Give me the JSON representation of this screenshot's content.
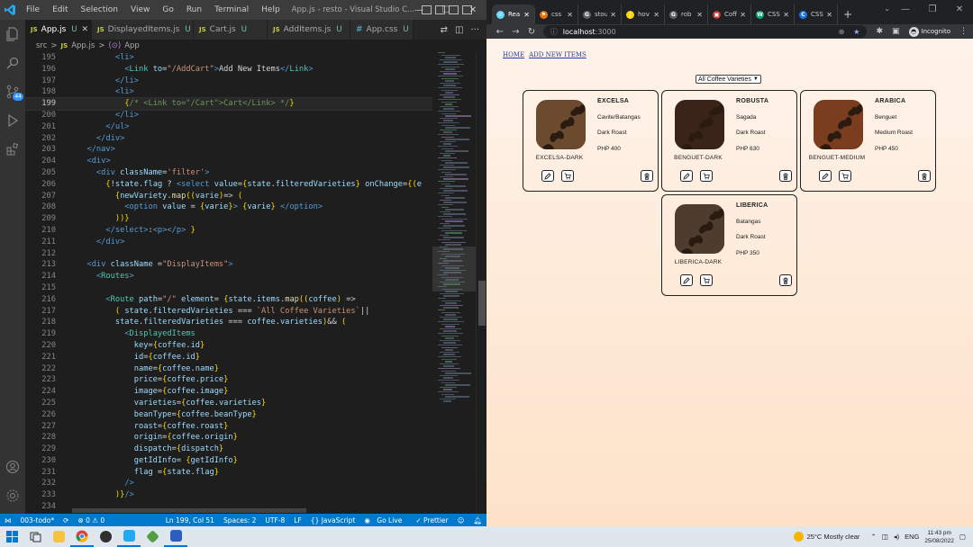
{
  "vscode": {
    "menu": [
      "File",
      "Edit",
      "Selection",
      "View",
      "Go",
      "Run",
      "Terminal",
      "Help"
    ],
    "window_title": "App.js - resto - Visual Studio C...",
    "tabs": [
      {
        "label": "App.js",
        "icon": "JS",
        "status": "U",
        "active": true
      },
      {
        "label": "DisplayedItems.js",
        "icon": "JS",
        "status": "U",
        "active": false
      },
      {
        "label": "Cart.js",
        "icon": "JS",
        "status": "U",
        "active": false
      },
      {
        "label": "AddItems.js",
        "icon": "JS",
        "status": "U",
        "active": false
      },
      {
        "label": "App.css",
        "icon": "#",
        "status": "U",
        "active": false
      }
    ],
    "breadcrumb": {
      "folder": "src",
      "file": "App.js",
      "symbol": "App"
    },
    "source_control_badge": "44",
    "current_line": 199,
    "status_bar": {
      "branch": "003-todo*",
      "sync": "⟳",
      "problems": "⊗ 0 ⚠ 0",
      "position": "Ln 199, Col 51",
      "spaces": "Spaces: 2",
      "encoding": "UTF-8",
      "eol": "LF",
      "language": "{} JavaScript",
      "golive": "Go Live",
      "prettier": "✓ Prettier"
    }
  },
  "code_lines": [
    {
      "n": 195,
      "t": [
        [
          "tx",
          "        "
        ],
        [
          "tg",
          "<li>"
        ]
      ]
    },
    {
      "n": 196,
      "t": [
        [
          "tx",
          "          "
        ],
        [
          "tg",
          "<"
        ],
        [
          "cp",
          "Link"
        ],
        [
          "tx",
          " "
        ],
        [
          "at",
          "to"
        ],
        [
          "tx",
          "="
        ],
        [
          "st",
          "\"/AddCart\""
        ],
        [
          "tg",
          ">"
        ],
        [
          "tx",
          "Add New Items"
        ],
        [
          "tg",
          "</"
        ],
        [
          "cp",
          "Link"
        ],
        [
          "tg",
          ">"
        ]
      ]
    },
    {
      "n": 197,
      "t": [
        [
          "tx",
          "        "
        ],
        [
          "tg",
          "</li>"
        ]
      ]
    },
    {
      "n": 198,
      "t": [
        [
          "tx",
          "        "
        ],
        [
          "tg",
          "<li>"
        ]
      ]
    },
    {
      "n": 199,
      "t": [
        [
          "tx",
          "          "
        ],
        [
          "br",
          "{"
        ],
        [
          "cm",
          "/* <Link to=\"/Cart\">Cart</Link> */"
        ],
        [
          "br",
          "}"
        ]
      ]
    },
    {
      "n": 200,
      "t": [
        [
          "tx",
          "        "
        ],
        [
          "tg",
          "</li>"
        ]
      ]
    },
    {
      "n": 201,
      "t": [
        [
          "tx",
          "      "
        ],
        [
          "tg",
          "</ul>"
        ]
      ]
    },
    {
      "n": 202,
      "t": [
        [
          "tx",
          "    "
        ],
        [
          "tg",
          "</div>"
        ]
      ]
    },
    {
      "n": 203,
      "t": [
        [
          "tx",
          "  "
        ],
        [
          "tg",
          "</nav>"
        ]
      ]
    },
    {
      "n": 204,
      "t": [
        [
          "tx",
          "  "
        ],
        [
          "tg",
          "<div>"
        ]
      ]
    },
    {
      "n": 205,
      "t": [
        [
          "tx",
          "    "
        ],
        [
          "tg",
          "<div"
        ],
        [
          "tx",
          " "
        ],
        [
          "at",
          "className"
        ],
        [
          "tx",
          "="
        ],
        [
          "st",
          "'filter'"
        ],
        [
          "tg",
          ">"
        ]
      ]
    },
    {
      "n": 206,
      "t": [
        [
          "tx",
          "      "
        ],
        [
          "br",
          "{"
        ],
        [
          "tx",
          "!"
        ],
        [
          "vr",
          "state"
        ],
        [
          "tx",
          "."
        ],
        [
          "vr",
          "flag"
        ],
        [
          "tx",
          " ? "
        ],
        [
          "tg",
          "<select"
        ],
        [
          "tx",
          " "
        ],
        [
          "at",
          "value"
        ],
        [
          "tx",
          "="
        ],
        [
          "br",
          "{"
        ],
        [
          "vr",
          "state"
        ],
        [
          "tx",
          "."
        ],
        [
          "vr",
          "filteredVarieties"
        ],
        [
          "br",
          "}"
        ],
        [
          "tx",
          " "
        ],
        [
          "at",
          "onChange"
        ],
        [
          "tx",
          "="
        ],
        [
          "br",
          "{("
        ],
        [
          "vr",
          "e"
        ]
      ]
    },
    {
      "n": 207,
      "t": [
        [
          "tx",
          "        "
        ],
        [
          "br",
          "{"
        ],
        [
          "vr",
          "newVariety"
        ],
        [
          "tx",
          "."
        ],
        [
          "fn",
          "map"
        ],
        [
          "br",
          "(("
        ],
        [
          "vr",
          "varie"
        ],
        [
          "br",
          ")"
        ],
        [
          "tx",
          "=> "
        ],
        [
          "br",
          "("
        ]
      ]
    },
    {
      "n": 208,
      "t": [
        [
          "tx",
          "          "
        ],
        [
          "tg",
          "<option"
        ],
        [
          "tx",
          " "
        ],
        [
          "at",
          "value"
        ],
        [
          "tx",
          " = "
        ],
        [
          "br",
          "{"
        ],
        [
          "vr",
          "varie"
        ],
        [
          "br",
          "}"
        ],
        [
          "tg",
          ">"
        ],
        [
          "tx",
          " "
        ],
        [
          "br",
          "{"
        ],
        [
          "vr",
          "varie"
        ],
        [
          "br",
          "}"
        ],
        [
          "tx",
          " "
        ],
        [
          "tg",
          "</option>"
        ]
      ]
    },
    {
      "n": 209,
      "t": [
        [
          "tx",
          "        "
        ],
        [
          "br",
          "))}"
        ]
      ]
    },
    {
      "n": 210,
      "t": [
        [
          "tx",
          "      "
        ],
        [
          "tg",
          "</select>"
        ],
        [
          "tx",
          ":"
        ],
        [
          "tg",
          "<p></p>"
        ],
        [
          "tx",
          " "
        ],
        [
          "br",
          "}"
        ]
      ]
    },
    {
      "n": 211,
      "t": [
        [
          "tx",
          "    "
        ],
        [
          "tg",
          "</div>"
        ]
      ]
    },
    {
      "n": 212,
      "t": [
        [
          "tx",
          ""
        ]
      ]
    },
    {
      "n": 213,
      "t": [
        [
          "tx",
          "  "
        ],
        [
          "tg",
          "<div"
        ],
        [
          "tx",
          " "
        ],
        [
          "at",
          "className"
        ],
        [
          "tx",
          " ="
        ],
        [
          "st",
          "\"DisplayItems\""
        ],
        [
          "tg",
          ">"
        ]
      ]
    },
    {
      "n": 214,
      "t": [
        [
          "tx",
          "    "
        ],
        [
          "tg",
          "<"
        ],
        [
          "cp",
          "Routes"
        ],
        [
          "tg",
          ">"
        ]
      ]
    },
    {
      "n": 215,
      "t": [
        [
          "tx",
          ""
        ]
      ]
    },
    {
      "n": 216,
      "t": [
        [
          "tx",
          "      "
        ],
        [
          "tg",
          "<"
        ],
        [
          "cp",
          "Route"
        ],
        [
          "tx",
          " "
        ],
        [
          "at",
          "path"
        ],
        [
          "tx",
          "="
        ],
        [
          "st",
          "\"/\""
        ],
        [
          "tx",
          " "
        ],
        [
          "at",
          "element"
        ],
        [
          "tx",
          "= "
        ],
        [
          "br",
          "{"
        ],
        [
          "vr",
          "state"
        ],
        [
          "tx",
          "."
        ],
        [
          "vr",
          "items"
        ],
        [
          "tx",
          "."
        ],
        [
          "fn",
          "map"
        ],
        [
          "br",
          "(("
        ],
        [
          "vr",
          "coffee"
        ],
        [
          "br",
          ")"
        ],
        [
          "tx",
          " =>"
        ]
      ]
    },
    {
      "n": 217,
      "t": [
        [
          "tx",
          "        "
        ],
        [
          "br",
          "("
        ],
        [
          "tx",
          " "
        ],
        [
          "vr",
          "state"
        ],
        [
          "tx",
          "."
        ],
        [
          "vr",
          "filteredVarieties"
        ],
        [
          "tx",
          " === "
        ],
        [
          "st",
          "`All Coffee Varieties`"
        ],
        [
          "tx",
          "||"
        ]
      ]
    },
    {
      "n": 218,
      "t": [
        [
          "tx",
          "        "
        ],
        [
          "vr",
          "state"
        ],
        [
          "tx",
          "."
        ],
        [
          "vr",
          "filteredVarieties"
        ],
        [
          "tx",
          " === "
        ],
        [
          "vr",
          "coffee"
        ],
        [
          "tx",
          "."
        ],
        [
          "vr",
          "varieties"
        ],
        [
          "br",
          ")"
        ],
        [
          "tx",
          "&& "
        ],
        [
          "br",
          "("
        ]
      ]
    },
    {
      "n": 219,
      "t": [
        [
          "tx",
          "          "
        ],
        [
          "tg",
          "<"
        ],
        [
          "cp",
          "DisplayedItems"
        ]
      ]
    },
    {
      "n": 220,
      "t": [
        [
          "tx",
          "            "
        ],
        [
          "at",
          "key"
        ],
        [
          "tx",
          "="
        ],
        [
          "br",
          "{"
        ],
        [
          "vr",
          "coffee"
        ],
        [
          "tx",
          "."
        ],
        [
          "vr",
          "id"
        ],
        [
          "br",
          "}"
        ]
      ]
    },
    {
      "n": 221,
      "t": [
        [
          "tx",
          "            "
        ],
        [
          "at",
          "id"
        ],
        [
          "tx",
          "="
        ],
        [
          "br",
          "{"
        ],
        [
          "vr",
          "coffee"
        ],
        [
          "tx",
          "."
        ],
        [
          "vr",
          "id"
        ],
        [
          "br",
          "}"
        ]
      ]
    },
    {
      "n": 222,
      "t": [
        [
          "tx",
          "            "
        ],
        [
          "at",
          "name"
        ],
        [
          "tx",
          "="
        ],
        [
          "br",
          "{"
        ],
        [
          "vr",
          "coffee"
        ],
        [
          "tx",
          "."
        ],
        [
          "vr",
          "name"
        ],
        [
          "br",
          "}"
        ]
      ]
    },
    {
      "n": 223,
      "t": [
        [
          "tx",
          "            "
        ],
        [
          "at",
          "price"
        ],
        [
          "tx",
          "="
        ],
        [
          "br",
          "{"
        ],
        [
          "vr",
          "coffee"
        ],
        [
          "tx",
          "."
        ],
        [
          "vr",
          "price"
        ],
        [
          "br",
          "}"
        ]
      ]
    },
    {
      "n": 224,
      "t": [
        [
          "tx",
          "            "
        ],
        [
          "at",
          "image"
        ],
        [
          "tx",
          "="
        ],
        [
          "br",
          "{"
        ],
        [
          "vr",
          "coffee"
        ],
        [
          "tx",
          "."
        ],
        [
          "vr",
          "image"
        ],
        [
          "br",
          "}"
        ]
      ]
    },
    {
      "n": 225,
      "t": [
        [
          "tx",
          "            "
        ],
        [
          "at",
          "varieties"
        ],
        [
          "tx",
          "="
        ],
        [
          "br",
          "{"
        ],
        [
          "vr",
          "coffee"
        ],
        [
          "tx",
          "."
        ],
        [
          "vr",
          "varieties"
        ],
        [
          "br",
          "}"
        ]
      ]
    },
    {
      "n": 226,
      "t": [
        [
          "tx",
          "            "
        ],
        [
          "at",
          "beanType"
        ],
        [
          "tx",
          "="
        ],
        [
          "br",
          "{"
        ],
        [
          "vr",
          "coffee"
        ],
        [
          "tx",
          "."
        ],
        [
          "vr",
          "beanType"
        ],
        [
          "br",
          "}"
        ]
      ]
    },
    {
      "n": 227,
      "t": [
        [
          "tx",
          "            "
        ],
        [
          "at",
          "roast"
        ],
        [
          "tx",
          "="
        ],
        [
          "br",
          "{"
        ],
        [
          "vr",
          "coffee"
        ],
        [
          "tx",
          "."
        ],
        [
          "vr",
          "roast"
        ],
        [
          "br",
          "}"
        ]
      ]
    },
    {
      "n": 228,
      "t": [
        [
          "tx",
          "            "
        ],
        [
          "at",
          "origin"
        ],
        [
          "tx",
          "="
        ],
        [
          "br",
          "{"
        ],
        [
          "vr",
          "coffee"
        ],
        [
          "tx",
          "."
        ],
        [
          "vr",
          "origin"
        ],
        [
          "br",
          "}"
        ]
      ]
    },
    {
      "n": 229,
      "t": [
        [
          "tx",
          "            "
        ],
        [
          "at",
          "dispatch"
        ],
        [
          "tx",
          "="
        ],
        [
          "br",
          "{"
        ],
        [
          "vr",
          "dispatch"
        ],
        [
          "br",
          "}"
        ]
      ]
    },
    {
      "n": 230,
      "t": [
        [
          "tx",
          "            "
        ],
        [
          "at",
          "getIdInfo"
        ],
        [
          "tx",
          "= "
        ],
        [
          "br",
          "{"
        ],
        [
          "vr",
          "getIdInfo"
        ],
        [
          "br",
          "}"
        ]
      ]
    },
    {
      "n": 231,
      "t": [
        [
          "tx",
          "            "
        ],
        [
          "at",
          "flag"
        ],
        [
          "tx",
          " ="
        ],
        [
          "br",
          "{"
        ],
        [
          "vr",
          "state"
        ],
        [
          "tx",
          "."
        ],
        [
          "vr",
          "flag"
        ],
        [
          "br",
          "}"
        ]
      ]
    },
    {
      "n": 232,
      "t": [
        [
          "tx",
          "          "
        ],
        [
          "tg",
          "/>"
        ]
      ]
    },
    {
      "n": 233,
      "t": [
        [
          "tx",
          "        "
        ],
        [
          "br",
          ")}"
        ],
        [
          "tg",
          "/>"
        ]
      ]
    },
    {
      "n": 234,
      "t": [
        [
          "tx",
          ""
        ]
      ]
    }
  ],
  "browser": {
    "tabs": [
      {
        "label": "Rea",
        "color": "#61dafb",
        "glyph": "⚛",
        "active": true
      },
      {
        "label": "css",
        "color": "#e8710a",
        "glyph": "⚑",
        "active": false
      },
      {
        "label": "stou",
        "color": "#5f6368",
        "glyph": "G",
        "active": false
      },
      {
        "label": "hov",
        "color": "#ffd200",
        "glyph": "∫",
        "active": false
      },
      {
        "label": "rob",
        "color": "#5f6368",
        "glyph": "G",
        "active": false
      },
      {
        "label": "Coff",
        "color": "#c0392b",
        "glyph": "▣",
        "active": false
      },
      {
        "label": "CSS",
        "color": "#04aa6d",
        "glyph": "W",
        "active": false
      },
      {
        "label": "CSS",
        "color": "#1a73e8",
        "glyph": "C",
        "active": false
      }
    ],
    "url_host": "localhost",
    "url_port": ":3000",
    "profile": "Incognito"
  },
  "app": {
    "nav": {
      "home": "HOME",
      "add": "ADD NEW ITEMS"
    },
    "filter_selected": "All Coffee Varieties",
    "cards": [
      {
        "name": "EXCELSA",
        "origin": "Cavite/Batangas",
        "roast": "Dark Roast",
        "price": "PHP 400",
        "variety": "EXCELSA-DARK",
        "bean": "#6b4a2e"
      },
      {
        "name": "ROBUSTA",
        "origin": "Sagada",
        "roast": "Dark Roast",
        "price": "PHP 630",
        "variety": "BENGUET-DARK",
        "bean": "#3a2419"
      },
      {
        "name": "ARABICA",
        "origin": "Benguet",
        "roast": "Medium Roast",
        "price": "PHP 450",
        "variety": "BENGUET-MEDIUM",
        "bean": "#7a3d1e"
      },
      {
        "name": "LIBERICA",
        "origin": "Batangas",
        "roast": "Dark Roast",
        "price": "PHP 350",
        "variety": "LIBERICA-DARK",
        "bean": "#4e3d2f"
      }
    ]
  },
  "taskbar": {
    "weather": "25°C  Mostly clear",
    "lang": "ENG",
    "time": "11:43 pm",
    "date": "25/08/2022"
  }
}
